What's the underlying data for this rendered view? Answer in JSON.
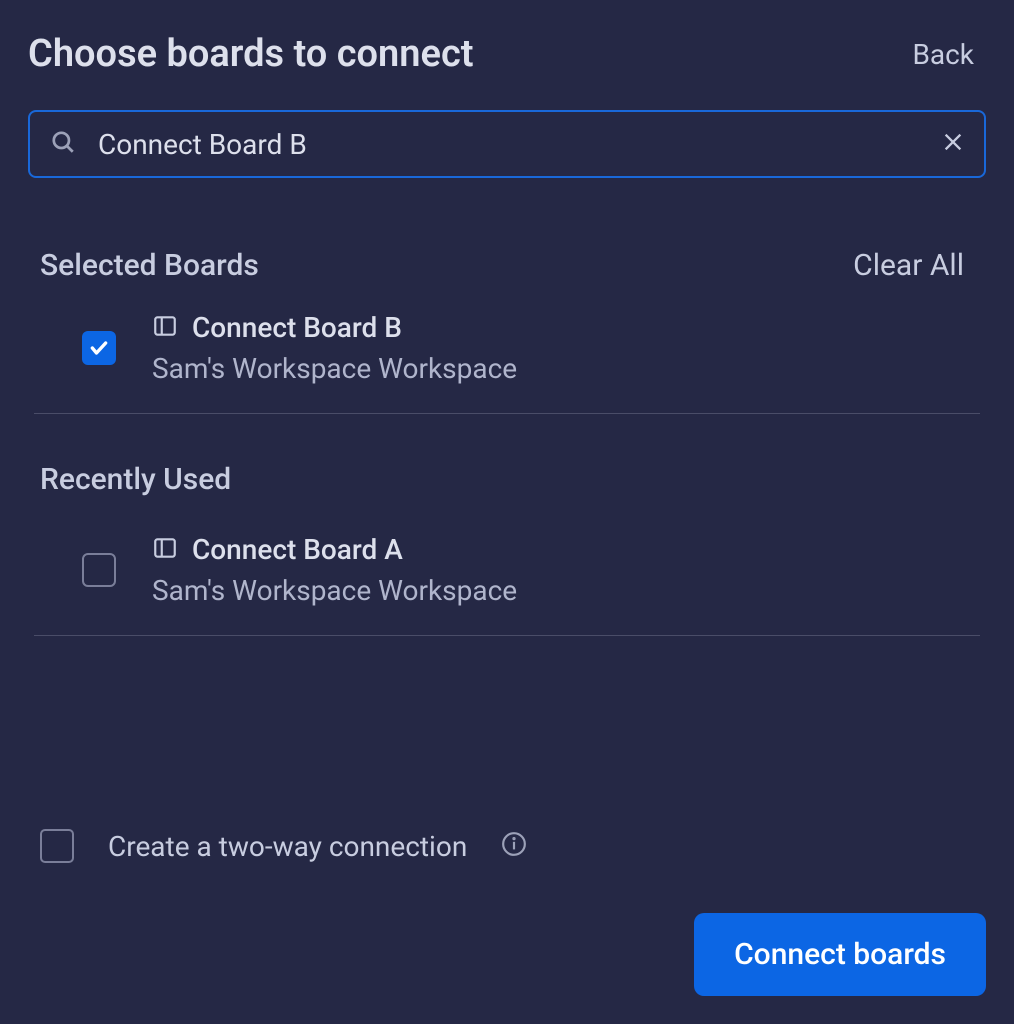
{
  "header": {
    "title": "Choose boards to connect",
    "back_label": "Back"
  },
  "search": {
    "value": "Connect Board B"
  },
  "selected": {
    "heading": "Selected Boards",
    "clear_all_label": "Clear All",
    "items": [
      {
        "name": "Connect Board B",
        "workspace": "Sam's Workspace Workspace",
        "checked": true
      }
    ]
  },
  "recent": {
    "heading": "Recently Used",
    "items": [
      {
        "name": "Connect Board A",
        "workspace": "Sam's Workspace Workspace",
        "checked": false
      }
    ]
  },
  "footer": {
    "two_way_label": "Create a two-way connection",
    "two_way_checked": false,
    "connect_button_label": "Connect boards"
  },
  "colors": {
    "accent": "#0c66e4",
    "focus_border": "#1968d9",
    "background": "#252845"
  }
}
